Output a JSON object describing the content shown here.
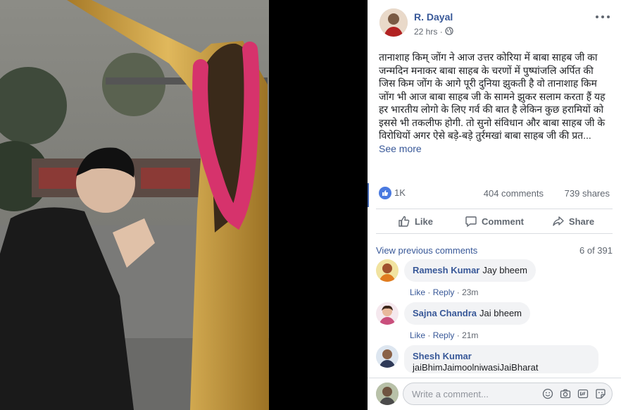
{
  "post": {
    "author": "R. Dayal",
    "time": "22 hrs",
    "separator": "·",
    "text": "तानाशाह किम् जोंग ने आज उत्तर कोरिया में बाबा साहब जी का जन्मदिन मनाकर बाबा साहब के चरणों में पुष्पांजलि अर्पित की जिस किम जोंग के आगे पूरी दुनिया झुकती है वो तानाशाह किम जोंग भी आज बाबा साहब जी के सामने झुकर सलाम करता हैं यह हर भारतीय लोगो के लिए गर्व की बात है लेकिन कुछ हरामियों को इससे भी तकलीफ होगी. तो सुनो संविधान और बाबा साहब जी के विरोधियों अगर ऐसे बड़े-बड़े तुर्रमखां बाबा साहब जी की प्रत...",
    "see_more": "See more"
  },
  "stats": {
    "reactions": "1K",
    "comments": "404 comments",
    "shares": "739 shares"
  },
  "actions": {
    "like": "Like",
    "comment": "Comment",
    "share": "Share"
  },
  "comments_section": {
    "view_previous": "View previous comments",
    "count": "6 of 391",
    "like_label": "Like",
    "reply_label": "Reply",
    "dot": "·",
    "items": [
      {
        "author": "Ramesh Kumar",
        "text": "Jay bheem",
        "time": "23m"
      },
      {
        "author": "Sajna Chandra",
        "text": "Jai bheem",
        "time": "21m"
      },
      {
        "author": "Shesh Kumar",
        "text": "jaiBhimJaimoolniwasiJaiBharat"
      }
    ]
  },
  "composer": {
    "placeholder": "Write a comment..."
  },
  "icons": {
    "more": "more-options-icon",
    "privacy": "globe-icon",
    "reaction": "like-reaction-icon",
    "emoji": "emoji-icon",
    "camera": "camera-icon",
    "gif": "gif-icon",
    "sticker": "sticker-icon"
  },
  "colors": {
    "link": "#385898",
    "like_blue": "#4a7ae0",
    "photo_statue": "#c79a3c",
    "garland": "#d6336c"
  }
}
